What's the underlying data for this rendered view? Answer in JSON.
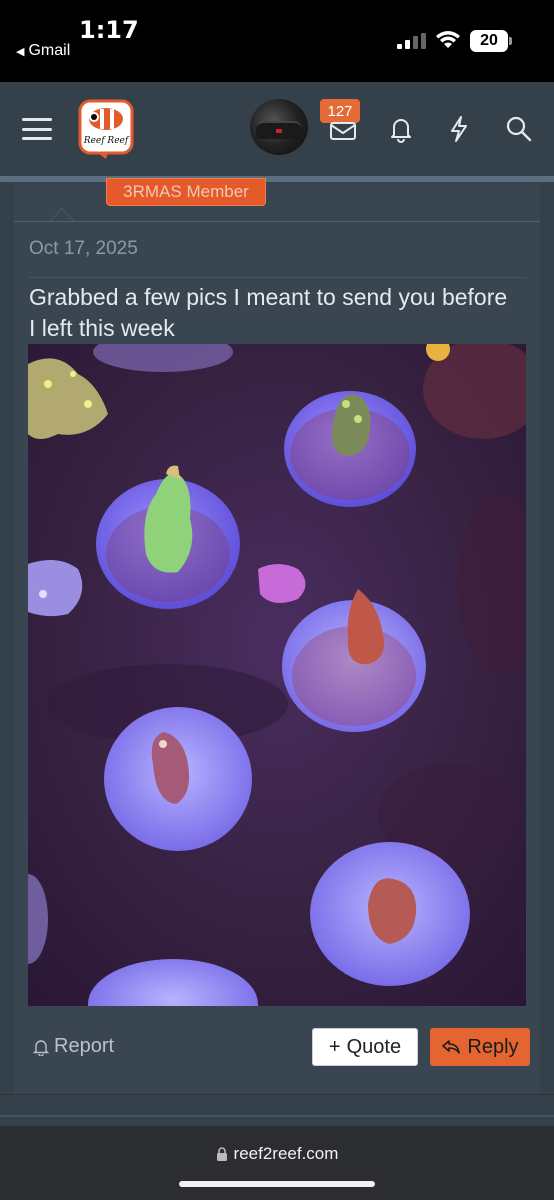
{
  "status_bar": {
    "time": "1:17",
    "back_app": "Gmail",
    "battery": "20"
  },
  "nav": {
    "logo_text": "Reef2Reef",
    "inbox_badge": "127"
  },
  "post": {
    "member_badge": "3RMAS Member",
    "date": "Oct 17, 2025",
    "text": "Grabbed a few pics I meant to send you before I left this week",
    "image_alt": "Photo of coral frags on frag plugs under blue/purple aquarium lighting"
  },
  "actions": {
    "report_label": "Report",
    "quote_label": "Quote",
    "reply_label": "Reply"
  },
  "browser": {
    "url": "reef2reef.com"
  },
  "colors": {
    "accent": "#e4652f",
    "nav_bg": "#34414b",
    "card_bg": "#394651"
  }
}
